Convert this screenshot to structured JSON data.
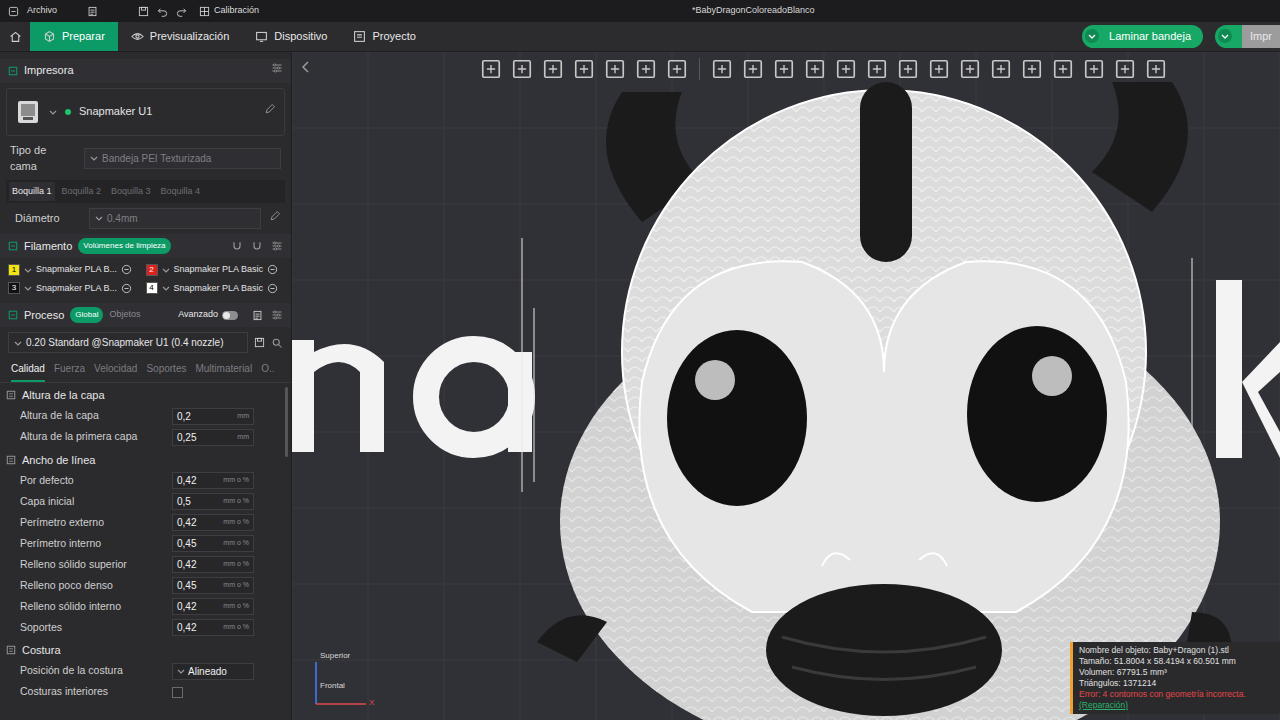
{
  "titlebar": {
    "menu": "Archivo",
    "calibration": "Calibración",
    "title": "*BabyDragonColoreadoBlanco"
  },
  "tabs": [
    {
      "label": "Preparar",
      "selected": true
    },
    {
      "label": "Previsualización",
      "selected": false
    },
    {
      "label": "Dispositivo",
      "selected": false
    },
    {
      "label": "Proyecto",
      "selected": false
    }
  ],
  "actions": {
    "slice": "Laminar bandeja",
    "print": "Impr"
  },
  "printer": {
    "header": "Impresora",
    "name": "Snapmaker U1",
    "connected": true,
    "bed_label": "Tipo de cama",
    "bed_value": "Bandeja PEI Texturizada",
    "nozzles": [
      {
        "label": "Boquilla 1",
        "selected": true
      },
      {
        "label": "Boquilla 2",
        "selected": false
      },
      {
        "label": "Boquilla 3",
        "selected": false
      },
      {
        "label": "Boquilla 4",
        "selected": false
      }
    ],
    "diameter_label": "Diámetro",
    "diameter_value": "0.4mm"
  },
  "filament": {
    "header": "Filamento",
    "badge": "Volúmenes de limpieza",
    "items": [
      {
        "index": "1",
        "name": "Snapmaker PLA B...",
        "color": "#f2e40c"
      },
      {
        "index": "2",
        "name": "Snapmaker PLA Basic",
        "color": "#e0201c"
      },
      {
        "index": "3",
        "name": "Snapmaker PLA B...",
        "color": "#111111"
      },
      {
        "index": "4",
        "name": "Snapmaker PLA Basic",
        "color": "#ffffff"
      }
    ]
  },
  "process": {
    "header": "Proceso",
    "scopes": [
      {
        "label": "Global",
        "selected": true
      },
      {
        "label": "Objetos",
        "selected": false
      }
    ],
    "advanced_label": "Avanzado",
    "advanced_on": false,
    "preset": "0.20 Standard @Snapmaker U1 (0.4 nozzle)",
    "tabs": [
      {
        "label": "Calidad",
        "selected": true
      },
      {
        "label": "Fuerza",
        "selected": false
      },
      {
        "label": "Velocidad",
        "selected": false
      },
      {
        "label": "Soportes",
        "selected": false
      },
      {
        "label": "Multimaterial",
        "selected": false
      },
      {
        "label": "O..",
        "selected": false
      }
    ],
    "groups": [
      {
        "title": "Altura de la capa",
        "rows": [
          {
            "kind": "number",
            "label": "Altura de la capa",
            "value": "0,2",
            "unit": "mm"
          },
          {
            "kind": "number",
            "label": "Altura de la primera capa",
            "value": "0,25",
            "unit": "mm"
          }
        ]
      },
      {
        "title": "Ancho de línea",
        "rows": [
          {
            "kind": "number",
            "label": "Por defecto",
            "value": "0,42",
            "unit": "mm o %"
          },
          {
            "kind": "number",
            "label": "Capa inicial",
            "value": "0,5",
            "unit": "mm o %"
          },
          {
            "kind": "number",
            "label": "Perímetro externo",
            "value": "0,42",
            "unit": "mm o %"
          },
          {
            "kind": "number",
            "label": "Perímetro interno",
            "value": "0,45",
            "unit": "mm o %"
          },
          {
            "kind": "number",
            "label": "Relleno sólido superior",
            "value": "0,42",
            "unit": "mm o %"
          },
          {
            "kind": "number",
            "label": "Relleno poco denso",
            "value": "0,45",
            "unit": "mm o %"
          },
          {
            "kind": "number",
            "label": "Relleno sólido interno",
            "value": "0,42",
            "unit": "mm o %"
          },
          {
            "kind": "number",
            "label": "Soportes",
            "value": "0,42",
            "unit": "mm o %"
          }
        ]
      },
      {
        "title": "Costura",
        "rows": [
          {
            "kind": "select",
            "label": "Posición de la costura",
            "value": "Alineado"
          },
          {
            "kind": "checkbox",
            "label": "Costuras interiores",
            "checked": false
          }
        ]
      }
    ]
  },
  "viewport": {
    "orientation": {
      "top": "Superior",
      "front": "Frontal",
      "x_axis": "X"
    },
    "info": {
      "lines": [
        "Nombre del objeto: Baby+Dragon (1).stl",
        "Tamaño: 51.8004 x 58.4194 x 60.501 mm",
        "Volumen: 67791.5 mm³",
        "Triángulos: 1371214"
      ],
      "error": "Error: 4 contornos con geometría incorrecta.",
      "repair": "(Reparación)"
    }
  }
}
